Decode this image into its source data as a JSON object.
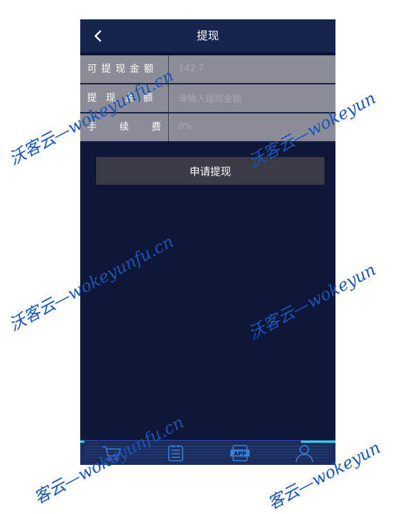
{
  "header": {
    "title": "提现"
  },
  "form": {
    "available_label": "可提现金额",
    "available_value": "142.7",
    "amount_label": "提现金额",
    "amount_placeholder": "请输入提现金额",
    "fee_label_chars": [
      "手",
      "续",
      "费"
    ],
    "fee_value": "0%"
  },
  "actions": {
    "submit_label": "申请提现"
  },
  "tabbar": {
    "icons": [
      "cart-icon",
      "list-icon",
      "app-icon",
      "user-icon"
    ],
    "app_badge": "APP",
    "accent_color": "#29d7ef"
  },
  "watermark": {
    "text": "沃客云—wokeyunfu.cn",
    "text_short": "沃客云—wokeyun",
    "text_partial": "客云—wokeyunfu.cn",
    "text_tail": "客云—wokeyun",
    "color": "#1c54b8"
  },
  "colors": {
    "page_bg": "#0e1737",
    "header_bg": "#16254f",
    "row_bg": "#8a8d98",
    "button_bg": "#3b3b46"
  }
}
